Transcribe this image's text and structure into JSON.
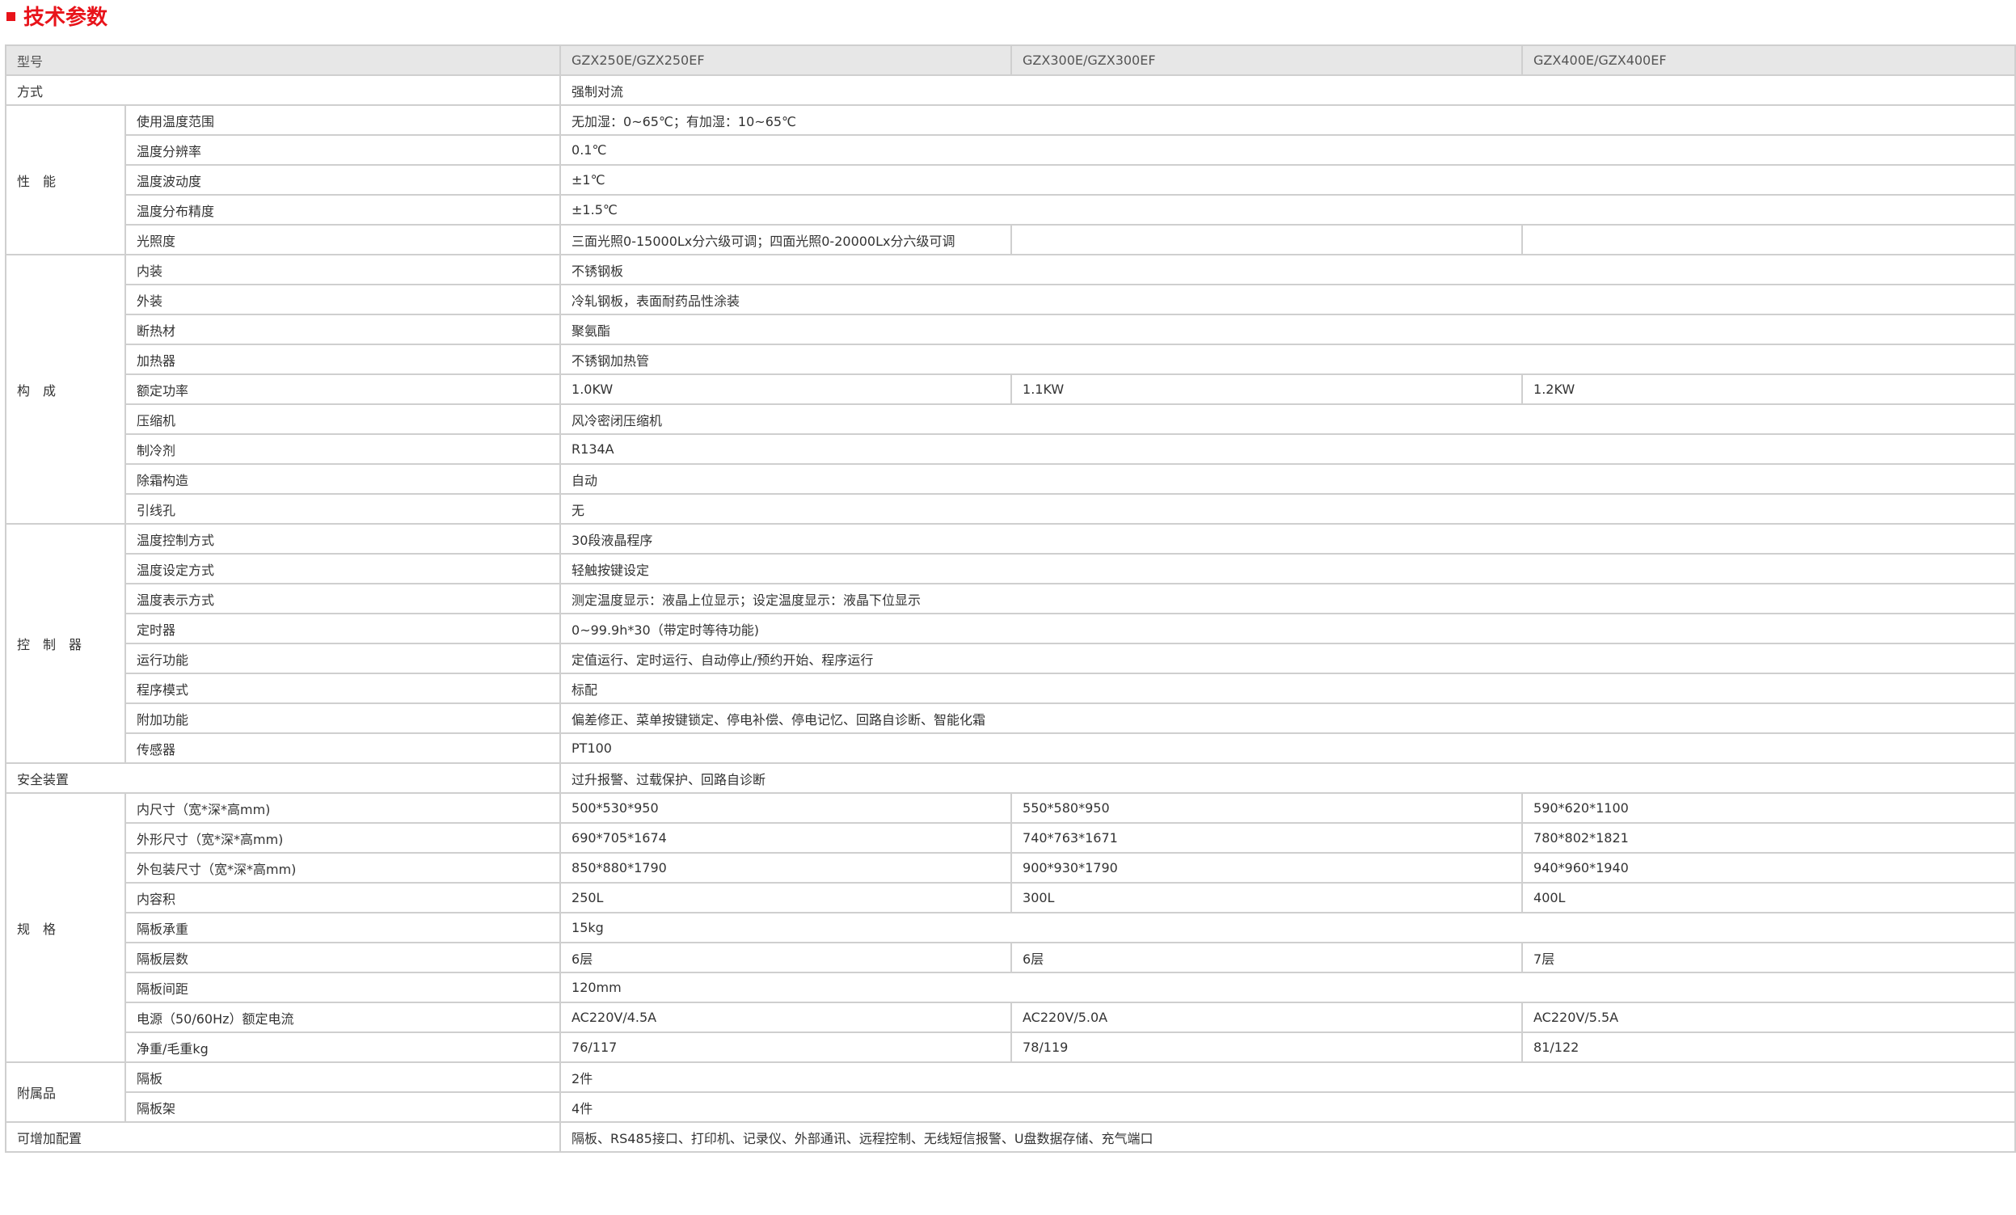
{
  "title": "技术参数",
  "header": {
    "label": "型号",
    "models": [
      "GZX250E/GZX250EF",
      "GZX300E/GZX300EF",
      "GZX400E/GZX400EF"
    ]
  },
  "rows": {
    "method": {
      "label": "方式",
      "value": "强制对流"
    },
    "performance": {
      "group": "性　能",
      "temp_range": {
        "label": "使用温度范围",
        "value": "无加湿：0~65℃；有加湿：10~65℃"
      },
      "temp_resolution": {
        "label": "温度分辨率",
        "value": "0.1℃"
      },
      "temp_fluctuation": {
        "label": "温度波动度",
        "value": "±1℃"
      },
      "temp_uniformity": {
        "label": "温度分布精度",
        "value": "±1.5℃"
      },
      "illuminance": {
        "label": "光照度",
        "value": "三面光照0-15000Lx分六级可调；四面光照0-20000Lx分六级可调"
      }
    },
    "construction": {
      "group": "构　成",
      "inner": {
        "label": "内装",
        "value": "不锈钢板"
      },
      "outer": {
        "label": "外装",
        "value": "冷轧钢板，表面耐药品性涂装"
      },
      "insulation": {
        "label": "断热材",
        "value": "聚氨酯"
      },
      "heater": {
        "label": "加热器",
        "value": "不锈钢加热管"
      },
      "rated_power": {
        "label": "额定功率",
        "values": [
          "1.0KW",
          "1.1KW",
          "1.2KW"
        ]
      },
      "compressor": {
        "label": "压缩机",
        "value": "风冷密闭压缩机"
      },
      "refrigerant": {
        "label": "制冷剂",
        "value": "R134A"
      },
      "defrost": {
        "label": "除霜构造",
        "value": "自动"
      },
      "cable_hole": {
        "label": "引线孔",
        "value": "无"
      }
    },
    "controller": {
      "group": "控　制　器",
      "temp_control": {
        "label": "温度控制方式",
        "value": "30段液晶程序"
      },
      "temp_setting": {
        "label": "温度设定方式",
        "value": "轻触按键设定"
      },
      "temp_display": {
        "label": "温度表示方式",
        "value": "测定温度显示：液晶上位显示；设定温度显示：液晶下位显示"
      },
      "timer": {
        "label": "定时器",
        "value": "0~99.9h*30（带定时等待功能)"
      },
      "run_function": {
        "label": "运行功能",
        "value": "定值运行、定时运行、自动停止/预约开始、程序运行"
      },
      "program_mode": {
        "label": "程序模式",
        "value": "标配"
      },
      "extra_function": {
        "label": "附加功能",
        "value": "偏差修正、菜单按键锁定、停电补偿、停电记忆、回路自诊断、智能化霜"
      },
      "sensor": {
        "label": "传感器",
        "value": "PT100"
      }
    },
    "safety": {
      "label": "安全装置",
      "value": "过升报警、过载保护、回路自诊断"
    },
    "specs": {
      "group": "规　格",
      "inner_size": {
        "label": "内尺寸（宽*深*高mm)",
        "values": [
          "500*530*950",
          "550*580*950",
          "590*620*1100"
        ]
      },
      "outer_size": {
        "label": "外形尺寸（宽*深*高mm)",
        "values": [
          "690*705*1674",
          "740*763*1671",
          "780*802*1821"
        ]
      },
      "package_size": {
        "label": "外包装尺寸（宽*深*高mm)",
        "values": [
          "850*880*1790",
          "900*930*1790",
          "940*960*1940"
        ]
      },
      "volume": {
        "label": "内容积",
        "values": [
          "250L",
          "300L",
          "400L"
        ]
      },
      "shelf_load": {
        "label": "隔板承重",
        "value": "15kg"
      },
      "shelf_layers": {
        "label": "隔板层数",
        "values": [
          "6层",
          "6层",
          "7层"
        ]
      },
      "shelf_spacing": {
        "label": "隔板间距",
        "value": "120mm"
      },
      "power_current": {
        "label": "电源（50/60Hz）额定电流",
        "values": [
          "AC220V/4.5A",
          "AC220V/5.0A",
          "AC220V/5.5A"
        ]
      },
      "weight": {
        "label": "净重/毛重kg",
        "values": [
          "76/117",
          "78/119",
          "81/122"
        ]
      }
    },
    "accessories": {
      "group": "附属品",
      "shelf": {
        "label": "隔板",
        "value": "2件"
      },
      "shelf_rack": {
        "label": "隔板架",
        "value": "4件"
      }
    },
    "options": {
      "label": "可增加配置",
      "value": "隔板、RS485接口、打印机、记录仪、外部通讯、远程控制、无线短信报警、U盘数据存储、充气端口"
    }
  }
}
